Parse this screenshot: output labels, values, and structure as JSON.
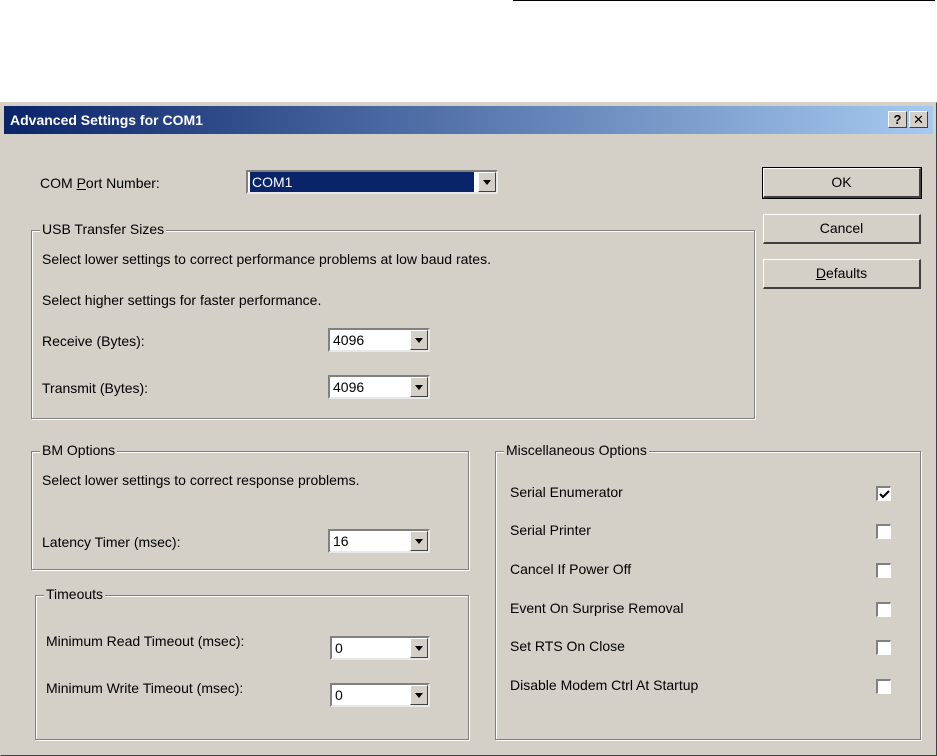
{
  "dialog": {
    "title": "Advanced Settings for COM1",
    "help_button": "?",
    "close_button": "✕",
    "com_port_label_pre": "COM ",
    "com_port_label_key": "P",
    "com_port_label_post": "ort Number:",
    "com_port_value": "COM1"
  },
  "buttons": {
    "ok": "OK",
    "cancel": "Cancel",
    "defaults_key": "D",
    "defaults_rest": "efaults"
  },
  "usb": {
    "legend": "USB Transfer Sizes",
    "hint_low": "Select lower settings to correct performance problems at low baud rates.",
    "hint_high": "Select higher settings for faster performance.",
    "receive_label": "Receive (Bytes):",
    "receive_value": "4096",
    "transmit_label": "Transmit (Bytes):",
    "transmit_value": "4096"
  },
  "bm": {
    "legend": "BM Options",
    "hint": "Select lower settings to correct response problems.",
    "latency_label": "Latency Timer (msec):",
    "latency_value": "16"
  },
  "timeouts": {
    "legend": "Timeouts",
    "read_label": "Minimum Read Timeout (msec):",
    "read_value": "0",
    "write_label": "Minimum Write Timeout (msec):",
    "write_value": "0"
  },
  "misc": {
    "legend": "Miscellaneous Options",
    "options": [
      {
        "label": "Serial Enumerator",
        "checked": true
      },
      {
        "label": "Serial Printer",
        "checked": false
      },
      {
        "label": "Cancel If Power Off",
        "checked": false
      },
      {
        "label": "Event On Surprise Removal",
        "checked": false
      },
      {
        "label": "Set RTS On Close",
        "checked": false
      },
      {
        "label": "Disable Modem Ctrl At Startup",
        "checked": false
      }
    ]
  },
  "colors": {
    "titlebar_start": "#0a246a",
    "titlebar_end": "#a6caf0",
    "dialog_bg": "#d4d0c8"
  },
  "icons": [
    "help-icon",
    "close-icon",
    "dropdown-arrow-icon",
    "checkmark-icon"
  ]
}
